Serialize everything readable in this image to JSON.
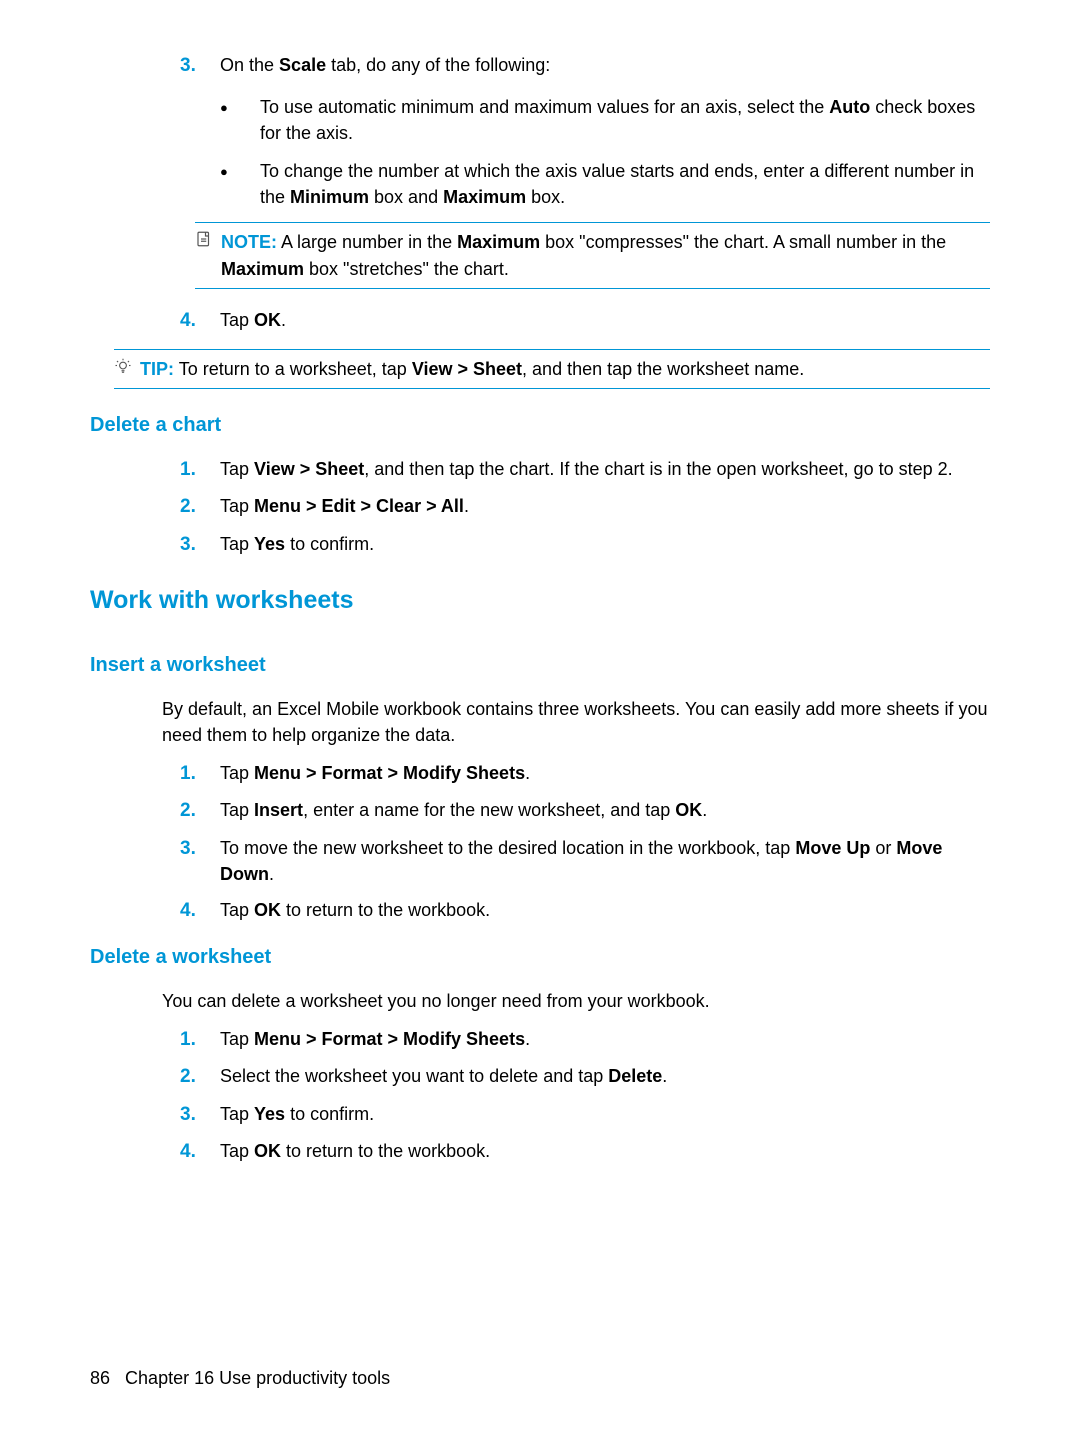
{
  "scale": {
    "step3_num": "3.",
    "step3_text_a": "On the ",
    "step3_bold": "Scale",
    "step3_text_b": " tab, do any of the following:",
    "bullet1_a": "To use automatic minimum and maximum values for an axis, select the ",
    "bullet1_bold": "Auto",
    "bullet1_b": " check boxes for the axis.",
    "bullet2_a": "To change the number at which the axis value starts and ends, enter a different number in the ",
    "bullet2_min": "Minimum",
    "bullet2_mid": " box and ",
    "bullet2_max": "Maximum",
    "bullet2_end": " box.",
    "note_label": "NOTE:",
    "note_a": "A large number in the ",
    "note_max1": "Maximum",
    "note_b": " box \"compresses\" the chart. A small number in the ",
    "note_max2": "Maximum",
    "note_c": " box \"stretches\" the chart.",
    "step4_num": "4.",
    "step4_a": "Tap ",
    "step4_ok": "OK",
    "step4_b": ".",
    "tip_label": "TIP:",
    "tip_a": "To return to a worksheet, tap ",
    "tip_viewsheet": "View > Sheet",
    "tip_b": ", and then tap the worksheet name."
  },
  "deleteChart": {
    "heading": "Delete a chart",
    "s1_num": "1.",
    "s1_a": "Tap ",
    "s1_vs": "View > Sheet",
    "s1_b": ", and then tap the chart. If the chart is in the open worksheet, go to step 2.",
    "s2_num": "2.",
    "s2_a": "Tap ",
    "s2_menu": "Menu > Edit > Clear > All",
    "s2_b": ".",
    "s3_num": "3.",
    "s3_a": "Tap ",
    "s3_yes": "Yes",
    "s3_b": " to confirm."
  },
  "wws": {
    "heading": "Work with worksheets"
  },
  "insertWs": {
    "heading": "Insert a worksheet",
    "intro": "By default, an Excel Mobile workbook contains three worksheets. You can easily add more sheets if you need them to help organize the data.",
    "s1_num": "1.",
    "s1_a": "Tap ",
    "s1_menu": "Menu > Format > Modify Sheets",
    "s1_b": ".",
    "s2_num": "2.",
    "s2_a": "Tap ",
    "s2_ins": "Insert",
    "s2_b": ", enter a name for the new worksheet, and tap ",
    "s2_ok": "OK",
    "s2_c": ".",
    "s3_num": "3.",
    "s3_a": "To move the new worksheet to the desired location in the workbook, tap ",
    "s3_mu": "Move Up",
    "s3_or": " or ",
    "s3_md": "Move Down",
    "s3_b": ".",
    "s4_num": "4.",
    "s4_a": "Tap ",
    "s4_ok": "OK",
    "s4_b": " to return to the workbook."
  },
  "deleteWs": {
    "heading": "Delete a worksheet",
    "intro": "You can delete a worksheet you no longer need from your workbook.",
    "s1_num": "1.",
    "s1_a": "Tap ",
    "s1_menu": "Menu > Format > Modify Sheets",
    "s1_b": ".",
    "s2_num": "2.",
    "s2_a": "Select the worksheet you want to delete and tap ",
    "s2_del": "Delete",
    "s2_b": ".",
    "s3_num": "3.",
    "s3_a": "Tap ",
    "s3_yes": "Yes",
    "s3_b": " to confirm.",
    "s4_num": "4.",
    "s4_a": "Tap ",
    "s4_ok": "OK",
    "s4_b": " to return to the workbook."
  },
  "footer": {
    "page": "86",
    "chapter": "Chapter 16   Use productivity tools"
  }
}
